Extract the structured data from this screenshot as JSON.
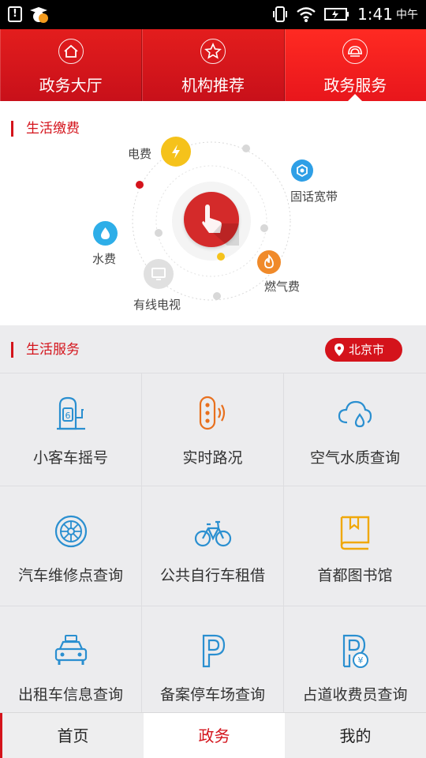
{
  "status_bar": {
    "time": "1:41",
    "ampm": "中午"
  },
  "top_tabs": [
    {
      "label": "政务大厅",
      "icon": "home-icon",
      "active": false
    },
    {
      "label": "机构推荐",
      "icon": "star-icon",
      "active": false
    },
    {
      "label": "政务服务",
      "icon": "service-icon",
      "active": true
    }
  ],
  "life_payment": {
    "title": "生活缴费",
    "items": [
      {
        "label": "电费",
        "icon": "electricity-icon",
        "color": "#f5c21b"
      },
      {
        "label": "固话宽带",
        "icon": "broadband-icon",
        "color": "#2e9fe6"
      },
      {
        "label": "水费",
        "icon": "water-icon",
        "color": "#2eaee8"
      },
      {
        "label": "燃气费",
        "icon": "gas-icon",
        "color": "#f08a2a"
      },
      {
        "label": "有线电视",
        "icon": "tv-icon",
        "color": "#d6d6d6"
      }
    ],
    "center_icon": "hand-pointer-icon"
  },
  "life_services": {
    "title": "生活服务",
    "city": "北京市",
    "items": [
      {
        "label": "小客车摇号",
        "icon": "car-lottery-icon"
      },
      {
        "label": "实时路况",
        "icon": "traffic-light-icon"
      },
      {
        "label": "空气水质查询",
        "icon": "air-water-icon"
      },
      {
        "label": "汽车维修点查询",
        "icon": "tire-icon"
      },
      {
        "label": "公共自行车租借",
        "icon": "bicycle-icon"
      },
      {
        "label": "首都图书馆",
        "icon": "library-book-icon"
      },
      {
        "label": "出租车信息查询",
        "icon": "taxi-icon"
      },
      {
        "label": "备案停车场查询",
        "icon": "parking-icon"
      },
      {
        "label": "占道收费员查询",
        "icon": "parking-fee-icon"
      }
    ]
  },
  "bottom_nav": [
    {
      "label": "首页",
      "active": false
    },
    {
      "label": "政务",
      "active": true
    },
    {
      "label": "我的",
      "active": false
    }
  ],
  "colors": {
    "brand_red": "#d4131b",
    "icon_blue": "#2a8fd0",
    "icon_orange": "#e8701e",
    "icon_yellow": "#f0a80a"
  }
}
